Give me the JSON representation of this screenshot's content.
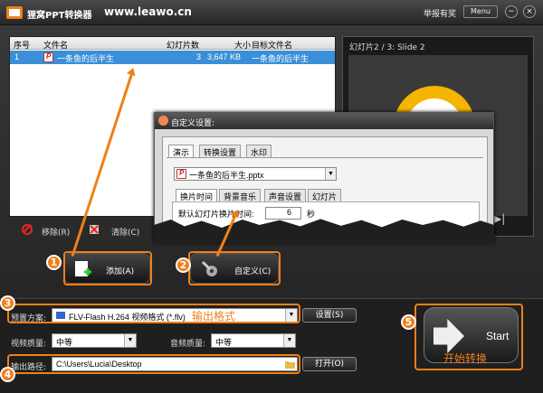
{
  "titlebar": {
    "app_name": "狸窝PPT转换器",
    "site": "www.leawo.cn",
    "report": "举报有奖",
    "menu": "Menu",
    "min": "−",
    "close": "×"
  },
  "table": {
    "headers": {
      "index": "序号",
      "filename": "文件名",
      "slides": "幻灯片数",
      "size": "大小",
      "target": "目标文件名"
    },
    "rows": [
      {
        "index": "1",
        "filename": "一条鱼的后半生",
        "slides": "3",
        "size": "3,647 KB",
        "target": "一条鱼的后半生"
      }
    ]
  },
  "list_actions": {
    "remove": "移除(R)",
    "clear": "清除(C)"
  },
  "preview": {
    "label": "幻灯片2 / 3: Slide 2"
  },
  "dialog": {
    "title": "自定义设置:",
    "tabs": [
      "演示",
      "转换设置",
      "水印"
    ],
    "file": "一条鱼的后半生.pptx",
    "inner_tabs": [
      "换片时间",
      "背景音乐",
      "声音设置",
      "幻灯片"
    ],
    "interval_label": "默认幻灯片换片时间:",
    "interval_value": "6",
    "interval_unit": "秒"
  },
  "buttons": {
    "add": "添加(A)",
    "custom": "自定义(C)",
    "settings": "设置(S)",
    "open": "打开(O)",
    "start": "Start"
  },
  "form": {
    "preset_label": "预置方案:",
    "preset_value": "FLV-Flash H.264 视频格式 (*.flv)",
    "preset_note": "输出格式",
    "video_quality_label": "视频质量:",
    "video_quality": "中等",
    "audio_quality_label": "音频质量:",
    "audio_quality": "中等",
    "output_label": "输出路径:",
    "output_path": "C:\\Users\\Lucia\\Desktop"
  },
  "annotations": {
    "n1": "1",
    "n2": "2",
    "n3": "3",
    "n4": "4",
    "n5": "5",
    "start_note": "开始转换"
  },
  "colors": {
    "accent": "#f07f1a",
    "selection": "#3a8fd8"
  }
}
